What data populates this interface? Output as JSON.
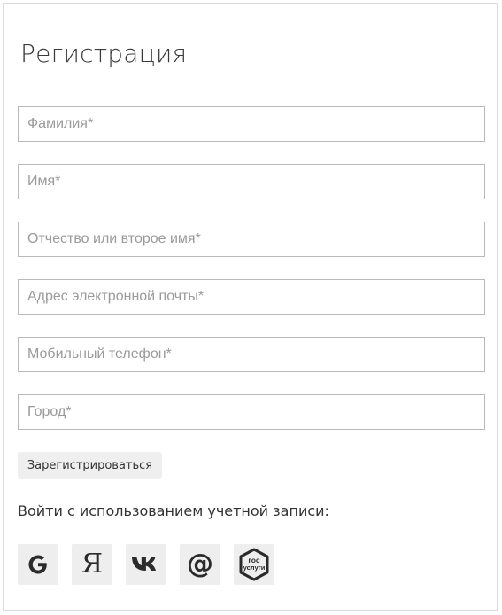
{
  "form": {
    "title": "Регистрация",
    "fields": [
      {
        "name": "last-name",
        "placeholder": "Фамилия*",
        "value": ""
      },
      {
        "name": "first-name",
        "placeholder": "Имя*",
        "value": ""
      },
      {
        "name": "middle-name",
        "placeholder": "Отчество или второе имя*",
        "value": ""
      },
      {
        "name": "email",
        "placeholder": "Адрес электронной почты*",
        "value": ""
      },
      {
        "name": "phone",
        "placeholder": "Мобильный телефон*",
        "value": ""
      },
      {
        "name": "city",
        "placeholder": "Город*",
        "value": ""
      }
    ],
    "submit_label": "Зарегистрироваться"
  },
  "social": {
    "label": "Войти с использованием учетной записи:",
    "providers": [
      {
        "name": "Google",
        "icon": "google-icon"
      },
      {
        "name": "Yandex",
        "icon": "yandex-icon",
        "glyph": "Я"
      },
      {
        "name": "VK",
        "icon": "vk-icon"
      },
      {
        "name": "Mail.ru",
        "icon": "mail-at-icon",
        "glyph": "@"
      },
      {
        "name": "Gosuslugi",
        "icon": "gosuslugi-icon",
        "line1": "гос",
        "line2": "услуги"
      }
    ]
  }
}
